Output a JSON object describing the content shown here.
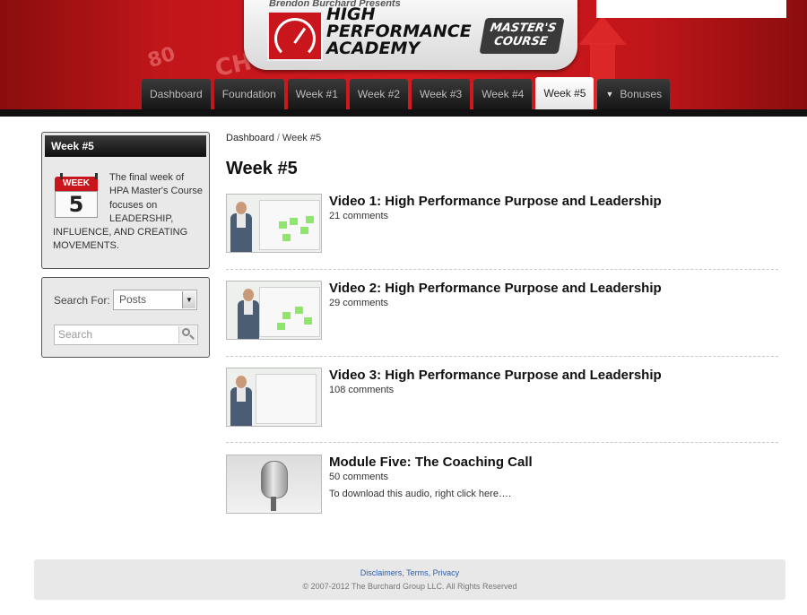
{
  "header": {
    "presents": "Brendon Burchard Presents",
    "logo_line1": "HIGH",
    "logo_line2": "PERFORMANCE",
    "logo_line3": "ACADEMY",
    "badge_line1": "MASTER'S",
    "badge_line2": "COURSE",
    "gauge_label": "CHANGE",
    "bg_speed_1": "80",
    "bg_speed_2": "CH",
    "accent_color": "#c8161c"
  },
  "nav": {
    "tabs": [
      {
        "label": "Dashboard"
      },
      {
        "label": "Foundation"
      },
      {
        "label": "Week #1"
      },
      {
        "label": "Week #2"
      },
      {
        "label": "Week #3"
      },
      {
        "label": "Week #4"
      },
      {
        "label": "Week #5",
        "active": true
      },
      {
        "label": "Bonuses",
        "has_dropdown": true
      }
    ]
  },
  "sidebar": {
    "week_widget": {
      "title": "Week #5",
      "calendar_month": "WEEK",
      "calendar_number": "5",
      "description": "The final week of HPA Master's Course focuses on LEADERSHIP, INFLUENCE, AND CREATING MOVEMENTS."
    },
    "search_widget": {
      "label": "Search For:",
      "select_value": "Posts",
      "search_placeholder": "Search"
    }
  },
  "main": {
    "breadcrumb": {
      "root": "Dashboard",
      "separator": "/",
      "current": "Week #5"
    },
    "title": "Week #5",
    "posts": [
      {
        "title": "Video 1: High Performance Purpose and Leadership",
        "comments": "21 comments",
        "excerpt": ""
      },
      {
        "title": "Video 2: High Performance Purpose and Leadership",
        "comments": "29 comments",
        "excerpt": ""
      },
      {
        "title": "Video 3: High Performance Purpose and Leadership",
        "comments": "108 comments",
        "excerpt": ""
      },
      {
        "title": "Module Five: The Coaching Call",
        "comments": "50 comments",
        "excerpt": "To download this audio, right click here…."
      }
    ]
  },
  "footer": {
    "links": [
      "Disclaimers",
      "Terms",
      "Privacy"
    ],
    "copyright": "© 2007-2012 The Burchard Group LLC. All Rights Reserved"
  }
}
